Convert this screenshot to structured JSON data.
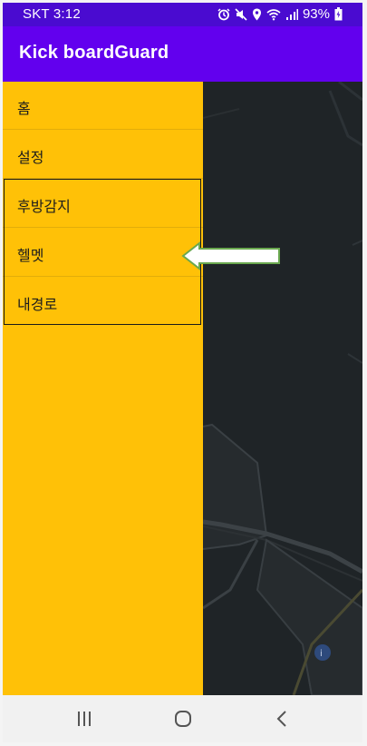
{
  "status_bar": {
    "carrier_time": "SKT 3:12",
    "battery": "93%",
    "icons": [
      "alarm-icon",
      "mute-icon",
      "location-icon",
      "wifi-icon",
      "signal-icon",
      "battery-icon"
    ]
  },
  "app_bar": {
    "title": "Kick boardGuard",
    "color": "#6200ee"
  },
  "drawer": {
    "background": "#ffc107",
    "items": [
      {
        "label": "홈"
      },
      {
        "label": "설정"
      },
      {
        "label": "후방감지"
      },
      {
        "label": "헬멧"
      },
      {
        "label": "내경로"
      }
    ]
  },
  "nav_bar": {
    "buttons": [
      "recents-icon",
      "home-icon",
      "back-icon"
    ]
  }
}
